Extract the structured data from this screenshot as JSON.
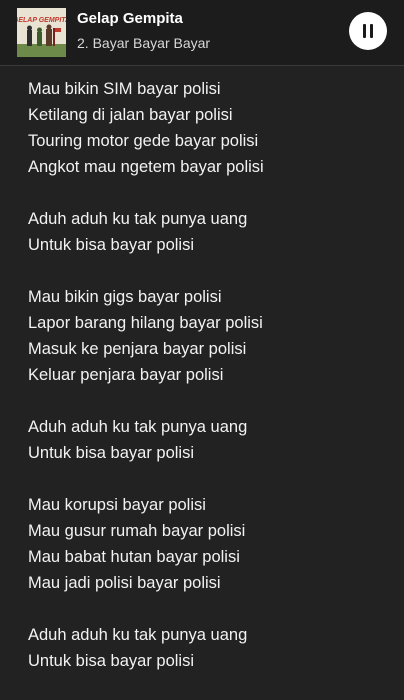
{
  "player": {
    "album": "Gelap Gempita",
    "track": "2. Bayar Bayar Bayar",
    "album_art_text": "GELAP GEMPITA",
    "pause_icon": "pause-icon"
  },
  "lyrics": {
    "stanzas": [
      [
        "Mau bikin SIM bayar polisi",
        "Ketilang di jalan bayar polisi",
        "Touring motor gede bayar polisi",
        "Angkot mau ngetem bayar polisi"
      ],
      [
        "Aduh aduh ku tak punya uang",
        "Untuk bisa bayar polisi"
      ],
      [
        "Mau bikin gigs bayar polisi",
        "Lapor barang hilang bayar polisi",
        "Masuk ke penjara bayar polisi",
        "Keluar penjara bayar polisi"
      ],
      [
        "Aduh aduh ku tak punya uang",
        "Untuk bisa bayar polisi"
      ],
      [
        "Mau korupsi bayar polisi",
        "Mau gusur rumah bayar polisi",
        "Mau babat hutan bayar polisi",
        "Mau jadi polisi bayar polisi"
      ],
      [
        "Aduh aduh ku tak punya uang",
        "Untuk bisa bayar polisi"
      ]
    ]
  }
}
